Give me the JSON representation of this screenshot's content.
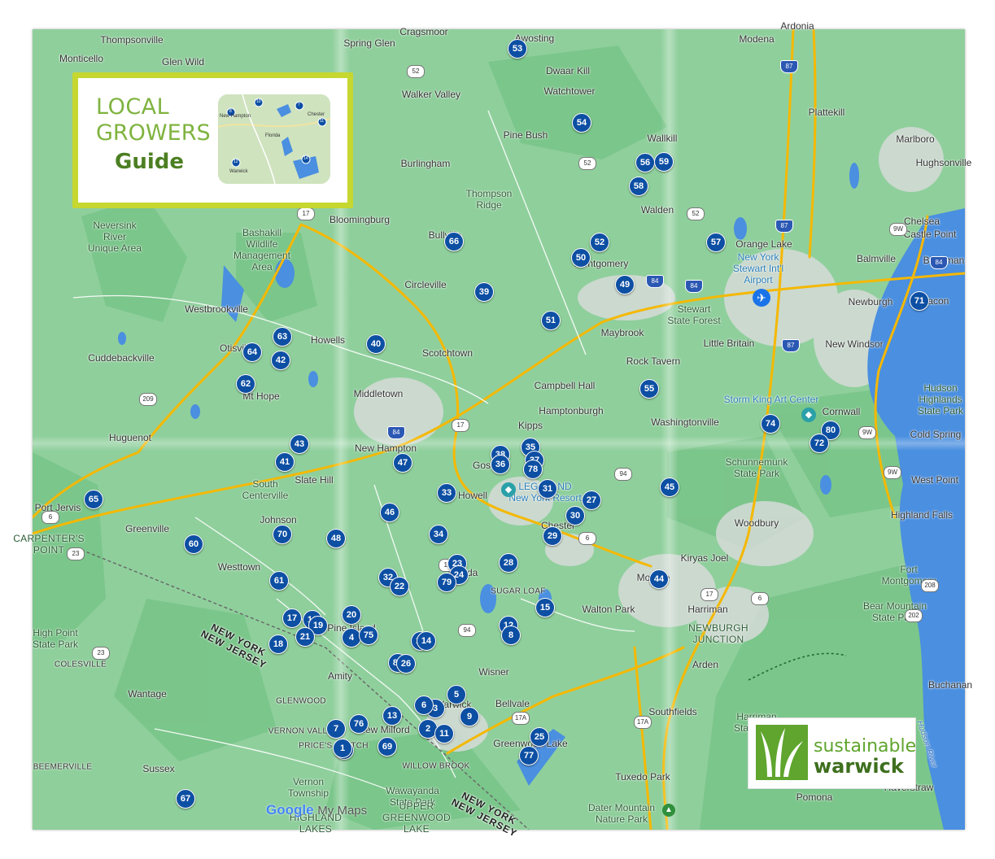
{
  "branding": {
    "guide_line1": "LOCAL",
    "guide_line2": "GROWERS",
    "guide_line3": "Guide",
    "guide_thumb_labels": [
      "New Hampton",
      "Florida",
      "Chester",
      "Warwick"
    ],
    "guide_thumb_markers": [
      "10",
      "8",
      "7",
      "11",
      "12",
      "14"
    ],
    "sw_line1": "sustainable",
    "sw_line2": "warwick",
    "google": "Google",
    "mymaps": "My Maps"
  },
  "colors": {
    "land": "#8fcf9c",
    "forest": "#7cc48c",
    "urban": "#d7dcd9",
    "water": "#4a8fe0",
    "highway": "#f5b800",
    "marker": "#0d4fa3",
    "guide_frame": "#c6d730",
    "brand_green": "#5fa52e"
  },
  "places": [
    {
      "name": "Thompsonville",
      "cls": ""
    },
    {
      "name": "Monticello",
      "cls": ""
    },
    {
      "name": "Glen Wild",
      "cls": ""
    },
    {
      "name": "Spring Glen",
      "cls": ""
    },
    {
      "name": "Cragsmoor",
      "cls": ""
    },
    {
      "name": "Awosting",
      "cls": ""
    },
    {
      "name": "Modena",
      "cls": ""
    },
    {
      "name": "Ardonia",
      "cls": ""
    },
    {
      "name": "Dwaar Kill",
      "cls": ""
    },
    {
      "name": "Walker Valley",
      "cls": ""
    },
    {
      "name": "Watchtower",
      "cls": ""
    },
    {
      "name": "Plattekill",
      "cls": ""
    },
    {
      "name": "Pine Bush",
      "cls": ""
    },
    {
      "name": "Wallkill",
      "cls": ""
    },
    {
      "name": "Marlboro",
      "cls": ""
    },
    {
      "name": "Burlingham",
      "cls": ""
    },
    {
      "name": "Thompson\nRidge",
      "cls": "park"
    },
    {
      "name": "Walden",
      "cls": ""
    },
    {
      "name": "Neversink\nRiver\nUnique Area",
      "cls": "park"
    },
    {
      "name": "Bashakill\nWildlife\nManagement\nArea",
      "cls": "park"
    },
    {
      "name": "Bloomingburg",
      "cls": ""
    },
    {
      "name": "Bullville",
      "cls": ""
    },
    {
      "name": "Chelsea",
      "cls": ""
    },
    {
      "name": "Castle Point",
      "cls": ""
    },
    {
      "name": "Orange Lake",
      "cls": ""
    },
    {
      "name": "Montgomery",
      "cls": ""
    },
    {
      "name": "New York\nStewart Int'l\nAirport",
      "cls": "poi park"
    },
    {
      "name": "Balmville",
      "cls": ""
    },
    {
      "name": "Circleville",
      "cls": ""
    },
    {
      "name": "Westbrookville",
      "cls": ""
    },
    {
      "name": "Newburgh",
      "cls": ""
    },
    {
      "name": "Beacon",
      "cls": ""
    },
    {
      "name": "Stewart\nState Forest",
      "cls": "park"
    },
    {
      "name": "Maybrook",
      "cls": ""
    },
    {
      "name": "Howells",
      "cls": ""
    },
    {
      "name": "Otisville",
      "cls": ""
    },
    {
      "name": "Cuddebackville",
      "cls": ""
    },
    {
      "name": "Scotchtown",
      "cls": ""
    },
    {
      "name": "Little Britain",
      "cls": ""
    },
    {
      "name": "New Windsor",
      "cls": ""
    },
    {
      "name": "Rock Tavern",
      "cls": ""
    },
    {
      "name": "Mt Hope",
      "cls": ""
    },
    {
      "name": "Middletown",
      "cls": ""
    },
    {
      "name": "Campbell Hall",
      "cls": ""
    },
    {
      "name": "Hamptonburgh",
      "cls": ""
    },
    {
      "name": "Hudson\nHighlands\nState Park",
      "cls": "park"
    },
    {
      "name": "Storm King Art Center",
      "cls": "poi"
    },
    {
      "name": "Cornwall",
      "cls": ""
    },
    {
      "name": "Washingtonville",
      "cls": ""
    },
    {
      "name": "Huguenot",
      "cls": ""
    },
    {
      "name": "Kipps",
      "cls": ""
    },
    {
      "name": "Cold Spring",
      "cls": ""
    },
    {
      "name": "New Hampton",
      "cls": ""
    },
    {
      "name": "Goshen",
      "cls": ""
    },
    {
      "name": "Schunnemunk\nState Park",
      "cls": "park"
    },
    {
      "name": "Slate Hill",
      "cls": ""
    },
    {
      "name": "LEGOLAND\nNew York Resort",
      "cls": "poi park"
    },
    {
      "name": "Howell",
      "cls": ""
    },
    {
      "name": "West Point",
      "cls": ""
    },
    {
      "name": "Port Jervis",
      "cls": ""
    },
    {
      "name": "South\nCenterville",
      "cls": "park"
    },
    {
      "name": "Highland Falls",
      "cls": ""
    },
    {
      "name": "Johnson",
      "cls": ""
    },
    {
      "name": "Chester",
      "cls": ""
    },
    {
      "name": "Woodbury",
      "cls": ""
    },
    {
      "name": "Greenville",
      "cls": ""
    },
    {
      "name": "CARPENTER'S\nPOINT",
      "cls": "small park"
    },
    {
      "name": "Kiryas Joel",
      "cls": ""
    },
    {
      "name": "Westtown",
      "cls": ""
    },
    {
      "name": "Monroe",
      "cls": ""
    },
    {
      "name": "Fort\nMontgomery",
      "cls": "park"
    },
    {
      "name": "SUGAR LOAF",
      "cls": "small"
    },
    {
      "name": "Florida",
      "cls": ""
    },
    {
      "name": "Walton Park",
      "cls": ""
    },
    {
      "name": "Harriman",
      "cls": ""
    },
    {
      "name": "Bear Mountain\nState Park",
      "cls": "park"
    },
    {
      "name": "NEWBURGH\nJUNCTION",
      "cls": "small park"
    },
    {
      "name": "High Point\nState Park",
      "cls": "park"
    },
    {
      "name": "Pine Island",
      "cls": ""
    },
    {
      "name": "Arden",
      "cls": ""
    },
    {
      "name": "COLESVILLE",
      "cls": "small"
    },
    {
      "name": "Amity",
      "cls": ""
    },
    {
      "name": "Wisner",
      "cls": ""
    },
    {
      "name": "Buchanan",
      "cls": ""
    },
    {
      "name": "Wantage",
      "cls": ""
    },
    {
      "name": "GLENWOOD",
      "cls": "small"
    },
    {
      "name": "Warwick",
      "cls": ""
    },
    {
      "name": "Bellvale",
      "cls": ""
    },
    {
      "name": "Southfields",
      "cls": ""
    },
    {
      "name": "Harriman\nState Park",
      "cls": "park"
    },
    {
      "name": "VERNON VALLEY",
      "cls": "small"
    },
    {
      "name": "New Milford",
      "cls": ""
    },
    {
      "name": "PRICE'S SWITCH",
      "cls": "small"
    },
    {
      "name": "Greenwood Lake",
      "cls": ""
    },
    {
      "name": "BEEMERVILLE",
      "cls": "small"
    },
    {
      "name": "WILLOW BROOK",
      "cls": "small"
    },
    {
      "name": "Sussex",
      "cls": ""
    },
    {
      "name": "Tuxedo Park",
      "cls": ""
    },
    {
      "name": "Haverstraw",
      "cls": ""
    },
    {
      "name": "Vernon\nTownship",
      "cls": "park"
    },
    {
      "name": "Wawayanda\nState Park",
      "cls": "park"
    },
    {
      "name": "Dater Mountain\nNature Park",
      "cls": "park"
    },
    {
      "name": "Pomona",
      "cls": ""
    },
    {
      "name": "HIGHLAND\nLAKES",
      "cls": "small park"
    },
    {
      "name": "UPPER\nGREENWOOD\nLAKE",
      "cls": "small park"
    },
    {
      "name": "Hudson River",
      "cls": "water"
    },
    {
      "name": "NEW YORK\nNEW JERSEY",
      "cls": "state"
    },
    {
      "name": "NEW YORK\nNEW JERSEY",
      "cls": "state"
    },
    {
      "name": "Hughsonville",
      "cls": ""
    },
    {
      "name": "Beekman",
      "cls": ""
    }
  ],
  "route_shields": [
    "52",
    "52",
    "52",
    "17",
    "17",
    "87",
    "87",
    "87",
    "84",
    "84",
    "84",
    "84",
    "9W",
    "9W",
    "9W",
    "209",
    "6",
    "6",
    "6",
    "23",
    "23",
    "17",
    "94",
    "94",
    "17A",
    "17A",
    "208",
    "202",
    "17"
  ],
  "markers": [
    "53",
    "54",
    "56",
    "59",
    "58",
    "66",
    "52",
    "50",
    "57",
    "49",
    "39",
    "71",
    "51",
    "63",
    "64",
    "42",
    "40",
    "62",
    "55",
    "74",
    "80",
    "72",
    "43",
    "41",
    "47",
    "38",
    "36",
    "35",
    "37",
    "78",
    "65",
    "31",
    "27",
    "33",
    "45",
    "46",
    "30",
    "34",
    "29",
    "48",
    "70",
    "60",
    "23",
    "24",
    "28",
    "79",
    "44",
    "32",
    "22",
    "61",
    "15",
    "20",
    "17",
    "16",
    "19",
    "21",
    "12",
    "8",
    "4",
    "75",
    "18",
    "10",
    "14",
    "81",
    "26",
    "5",
    "3",
    "9",
    "13",
    "76",
    "7",
    "2",
    "11",
    "25",
    "68",
    "69",
    "77",
    "67",
    "1",
    "6"
  ]
}
